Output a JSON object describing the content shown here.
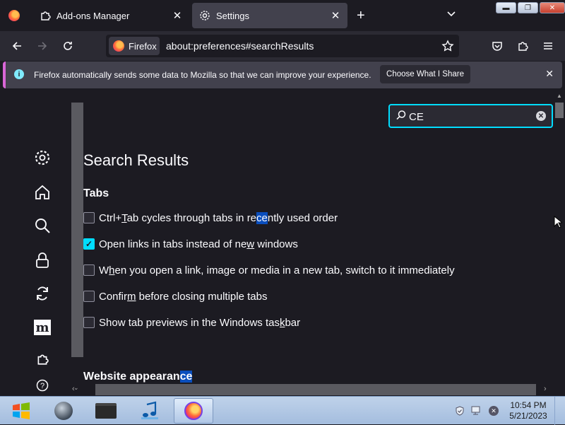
{
  "tabs": [
    {
      "label": "Add-ons Manager"
    },
    {
      "label": "Settings"
    }
  ],
  "toolbar": {
    "identity_label": "Firefox",
    "url": "about:preferences#searchResults"
  },
  "notification": {
    "text": "Firefox automatically sends some data to Mozilla so that we can improve your experience.",
    "button": "Choose What I Share"
  },
  "search": {
    "value": "CE"
  },
  "results": {
    "title": "Search Results",
    "tabs_heading": "Tabs",
    "options": [
      {
        "pre": "Ctrl+",
        "ul": "T",
        "mid": "ab cycles through tabs in re",
        "hl": "ce",
        "post": "ntly used order",
        "checked": false
      },
      {
        "pre": "Open links in tabs instead of ne",
        "ul": "w",
        "mid": " windows",
        "checked": true
      },
      {
        "pre": "W",
        "ul": "h",
        "mid": "en you open a link, image or media in a new tab, switch to it immediately",
        "checked": false
      },
      {
        "pre": "Confir",
        "ul": "m",
        "mid": " before closing multiple tabs",
        "checked": false
      },
      {
        "pre": "Show tab previews in the Windows tas",
        "ul": "k",
        "mid": "bar",
        "checked": false
      }
    ],
    "appearance_heading_pre": "Website appearan",
    "appearance_heading_hl": "ce"
  },
  "taskbar": {
    "time": "10:54 PM",
    "date": "5/21/2023"
  },
  "colors": {
    "accent": "#00ddff",
    "highlight": "#0a4ebd",
    "notification_border": "#d966d7"
  }
}
